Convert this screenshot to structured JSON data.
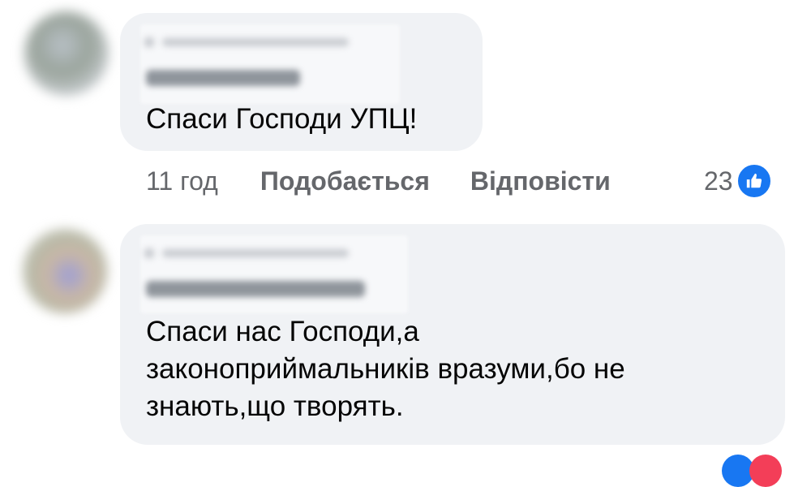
{
  "comments": [
    {
      "text": "Спаси Господи УПЦ!",
      "time": "11 год",
      "like_label": "Подобається",
      "reply_label": "Відповісти",
      "reaction_count": "23",
      "reaction_icon": "like-icon"
    },
    {
      "text": "Спаси нас Господи,а\nзаконоприймальників вразуми,бо не\nзнають,що творять."
    }
  ],
  "colors": {
    "bubble": "#f0f2f5",
    "secondary_text": "#65676b",
    "like_blue": "#1877f2",
    "love_red": "#f33e58"
  }
}
